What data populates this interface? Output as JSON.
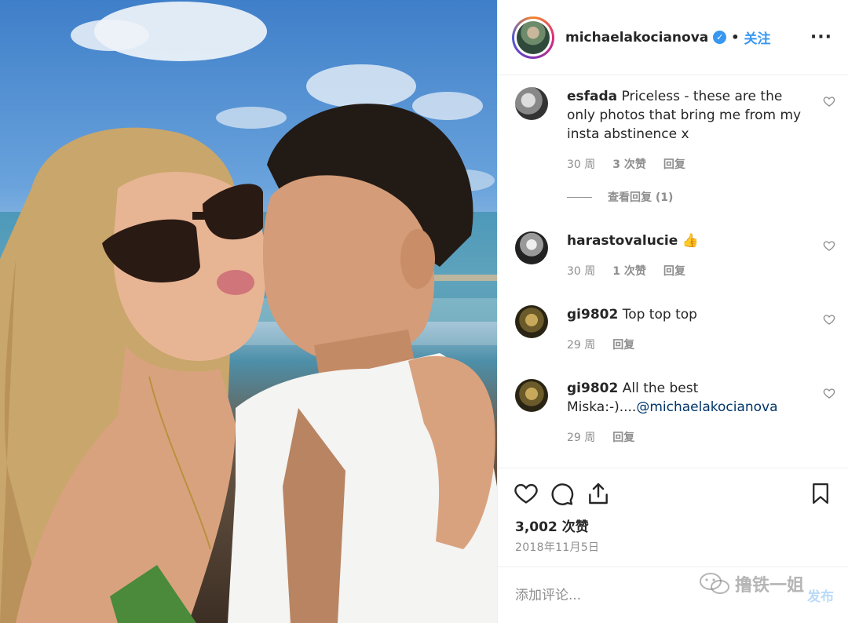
{
  "post": {
    "username": "michaelakocianova",
    "verified_icon": "✓",
    "separator": "•",
    "follow_label": "关注",
    "more_label": "···"
  },
  "comments": [
    {
      "user": "esfada",
      "text": "Priceless - these are the only photos that bring me from my insta abstinence x",
      "time": "30 周",
      "likes": "3 次赞",
      "reply": "回复",
      "view_replies": "查看回复 (1)"
    },
    {
      "user": "harastovalucie",
      "text": "👍",
      "time": "30 周",
      "likes": "1 次赞",
      "reply": "回复"
    },
    {
      "user": "gi9802",
      "text": "Top top top",
      "time": "29 周",
      "reply": "回复"
    },
    {
      "user": "gi9802",
      "text": "All the best Miska:-)....",
      "mention": "@michaelakocianova",
      "time": "29 周",
      "reply": "回复"
    }
  ],
  "stats": {
    "likes": "3,002 次赞",
    "date": "2018年11月5日"
  },
  "composer": {
    "placeholder": "添加评论...",
    "publish_label": "发布"
  },
  "watermark": {
    "text": "撸铁一姐"
  },
  "colors": {
    "accent": "#3897f0",
    "text": "#262626",
    "muted": "#8e8e8e",
    "border": "#efefef"
  }
}
